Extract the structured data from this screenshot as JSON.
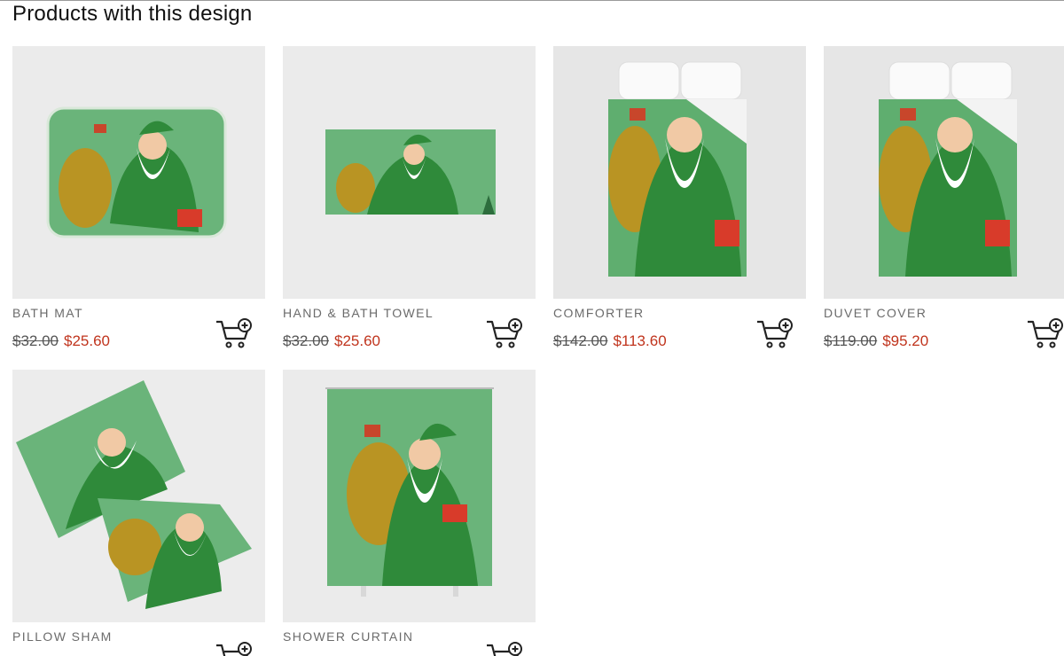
{
  "section": {
    "title": "Products with this design"
  },
  "colors": {
    "price_sale": "#c0341d",
    "price_old": "#555555",
    "label": "#6b6b6b",
    "design_green": "#2f8a3a"
  },
  "products": [
    {
      "name": "BATH MAT",
      "old_price": "$32.00",
      "price": "$25.60",
      "image": "bath-mat-santa"
    },
    {
      "name": "HAND & BATH TOWEL",
      "old_price": "$32.00",
      "price": "$25.60",
      "image": "towel-santa"
    },
    {
      "name": "COMFORTER",
      "old_price": "$142.00",
      "price": "$113.60",
      "image": "comforter-santa"
    },
    {
      "name": "DUVET COVER",
      "old_price": "$119.00",
      "price": "$95.20",
      "image": "duvet-santa"
    },
    {
      "name": "PILLOW SHAM",
      "old_price": "",
      "price": "",
      "image": "pillow-sham-santa"
    },
    {
      "name": "SHOWER CURTAIN",
      "old_price": "",
      "price": "",
      "image": "shower-curtain-santa"
    }
  ],
  "icons": {
    "cart": "add-to-cart-icon"
  }
}
